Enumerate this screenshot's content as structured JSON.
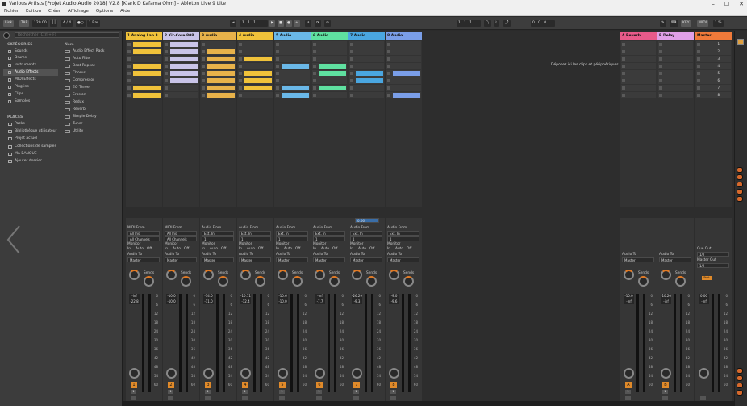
{
  "window": {
    "title": "Various Artists [Projet Audio Audio 2018] V2.8 [Klark D  Kafama Ohm] - Ableton Live 9 Lite"
  },
  "menu": [
    "Fichier",
    "Edition",
    "Créer",
    "Affichage",
    "Options",
    "Aide"
  ],
  "toolbar": {
    "link": "Link",
    "tap": "TAP",
    "tempo": "120.00",
    "sig": "4 / 4",
    "quant": "1 Bar",
    "pos": "1 . 1 . 1",
    "pos2": "1 . 1 . 1",
    "pos3": "0 . 0 . 0",
    "key": "KEY",
    "midi": "MIDI",
    "cpu": "1 %"
  },
  "browser": {
    "search_placeholder": "Rechercher (Ctrl + F)",
    "categories_label": "CATÉGORIES",
    "name_label": "Nom",
    "categories": [
      "Sounds",
      "Drums",
      "Instruments",
      "Audio Effects",
      "MIDI Effects",
      "Plug-ins",
      "Clips",
      "Samples"
    ],
    "effects": [
      "Audio Effect Rack",
      "Auto Filter",
      "Beat Repeat",
      "Chorus",
      "Compressor",
      "EQ Three",
      "Erosion",
      "Redux",
      "Reverb",
      "Simple Delay",
      "Tuner",
      "Utility"
    ],
    "places_label": "PLACES",
    "places": [
      "Packs",
      "Bibliothèque utilisateur",
      "Projet actuel",
      "Collections de samples",
      "MA BANQUE",
      "Ajouter dossier..."
    ]
  },
  "tracks": [
    {
      "name": "1 Analog Lab 3",
      "color": "#f0c23a",
      "num": "1",
      "vol": "-inf",
      "pan": "-22.8"
    },
    {
      "name": "2 Kit-Core 808",
      "color": "#c9c4e8",
      "num": "2",
      "vol": "-10.0",
      "pan": "-10.0"
    },
    {
      "name": "3 Audio",
      "color": "#e8b24a",
      "num": "3",
      "vol": "-14.0",
      "pan": "-11.0"
    },
    {
      "name": "4 Audio",
      "color": "#f0c23a",
      "num": "4",
      "vol": "-10.11",
      "pan": "-12.4"
    },
    {
      "name": "5 Audio",
      "color": "#6ab8e8",
      "num": "5",
      "vol": "-10.6",
      "pan": "-10.0"
    },
    {
      "name": "6 Audio",
      "color": "#5fe0a0",
      "num": "6",
      "vol": "-inf",
      "pan": "-7.7"
    },
    {
      "name": "7 Audio",
      "color": "#4aa6e0",
      "num": "7",
      "vol": "-26.29",
      "pan": "-9.3"
    },
    {
      "name": "8 Audio",
      "color": "#7a9ee8",
      "num": "8",
      "vol": "-9.0",
      "pan": "-9.6"
    }
  ],
  "returns": [
    {
      "name": "A Reverb",
      "color": "#e85a8a",
      "num": "A",
      "vol": "-10.0",
      "pan": "-inf"
    },
    {
      "name": "B Delay",
      "color": "#e0a0e8",
      "num": "B",
      "vol": "-10.20",
      "pan": "-inf"
    }
  ],
  "master": {
    "name": "Master",
    "color": "#f07a3a",
    "vol": "0.00",
    "pan": "-inf"
  },
  "scenes": [
    "1",
    "2",
    "3",
    "4",
    "5",
    "6",
    "7",
    "8"
  ],
  "clip_labels": {
    "tr6": "FunkyRhythm_1",
    "tr7a": "Synth Loop 128",
    "tr7b": "Synth Loop 128",
    "tr7c": "Synth Loop 128"
  },
  "drop_text": "Déposez ici les clips et périphériques",
  "mixer": {
    "midi_from": "MIDI From",
    "all_ins": "All Ins",
    "all_channels": "All Channels",
    "audio_from": "Audio From",
    "ext_in": "Ext. In",
    "monitor": "Monitor",
    "in": "In",
    "auto": "Auto",
    "off": "Off",
    "audio_to": "Audio To",
    "master": "Master",
    "sends": "Sends",
    "cue_out": "Cue Out",
    "master_out": "Master Out",
    "cue_val": "1/2",
    "master_val": "1/2",
    "post": "Post",
    "level7": "0.06"
  },
  "scale": [
    "0",
    "6",
    "12",
    "18",
    "24",
    "30",
    "36",
    "42",
    "48",
    "54",
    "60"
  ]
}
